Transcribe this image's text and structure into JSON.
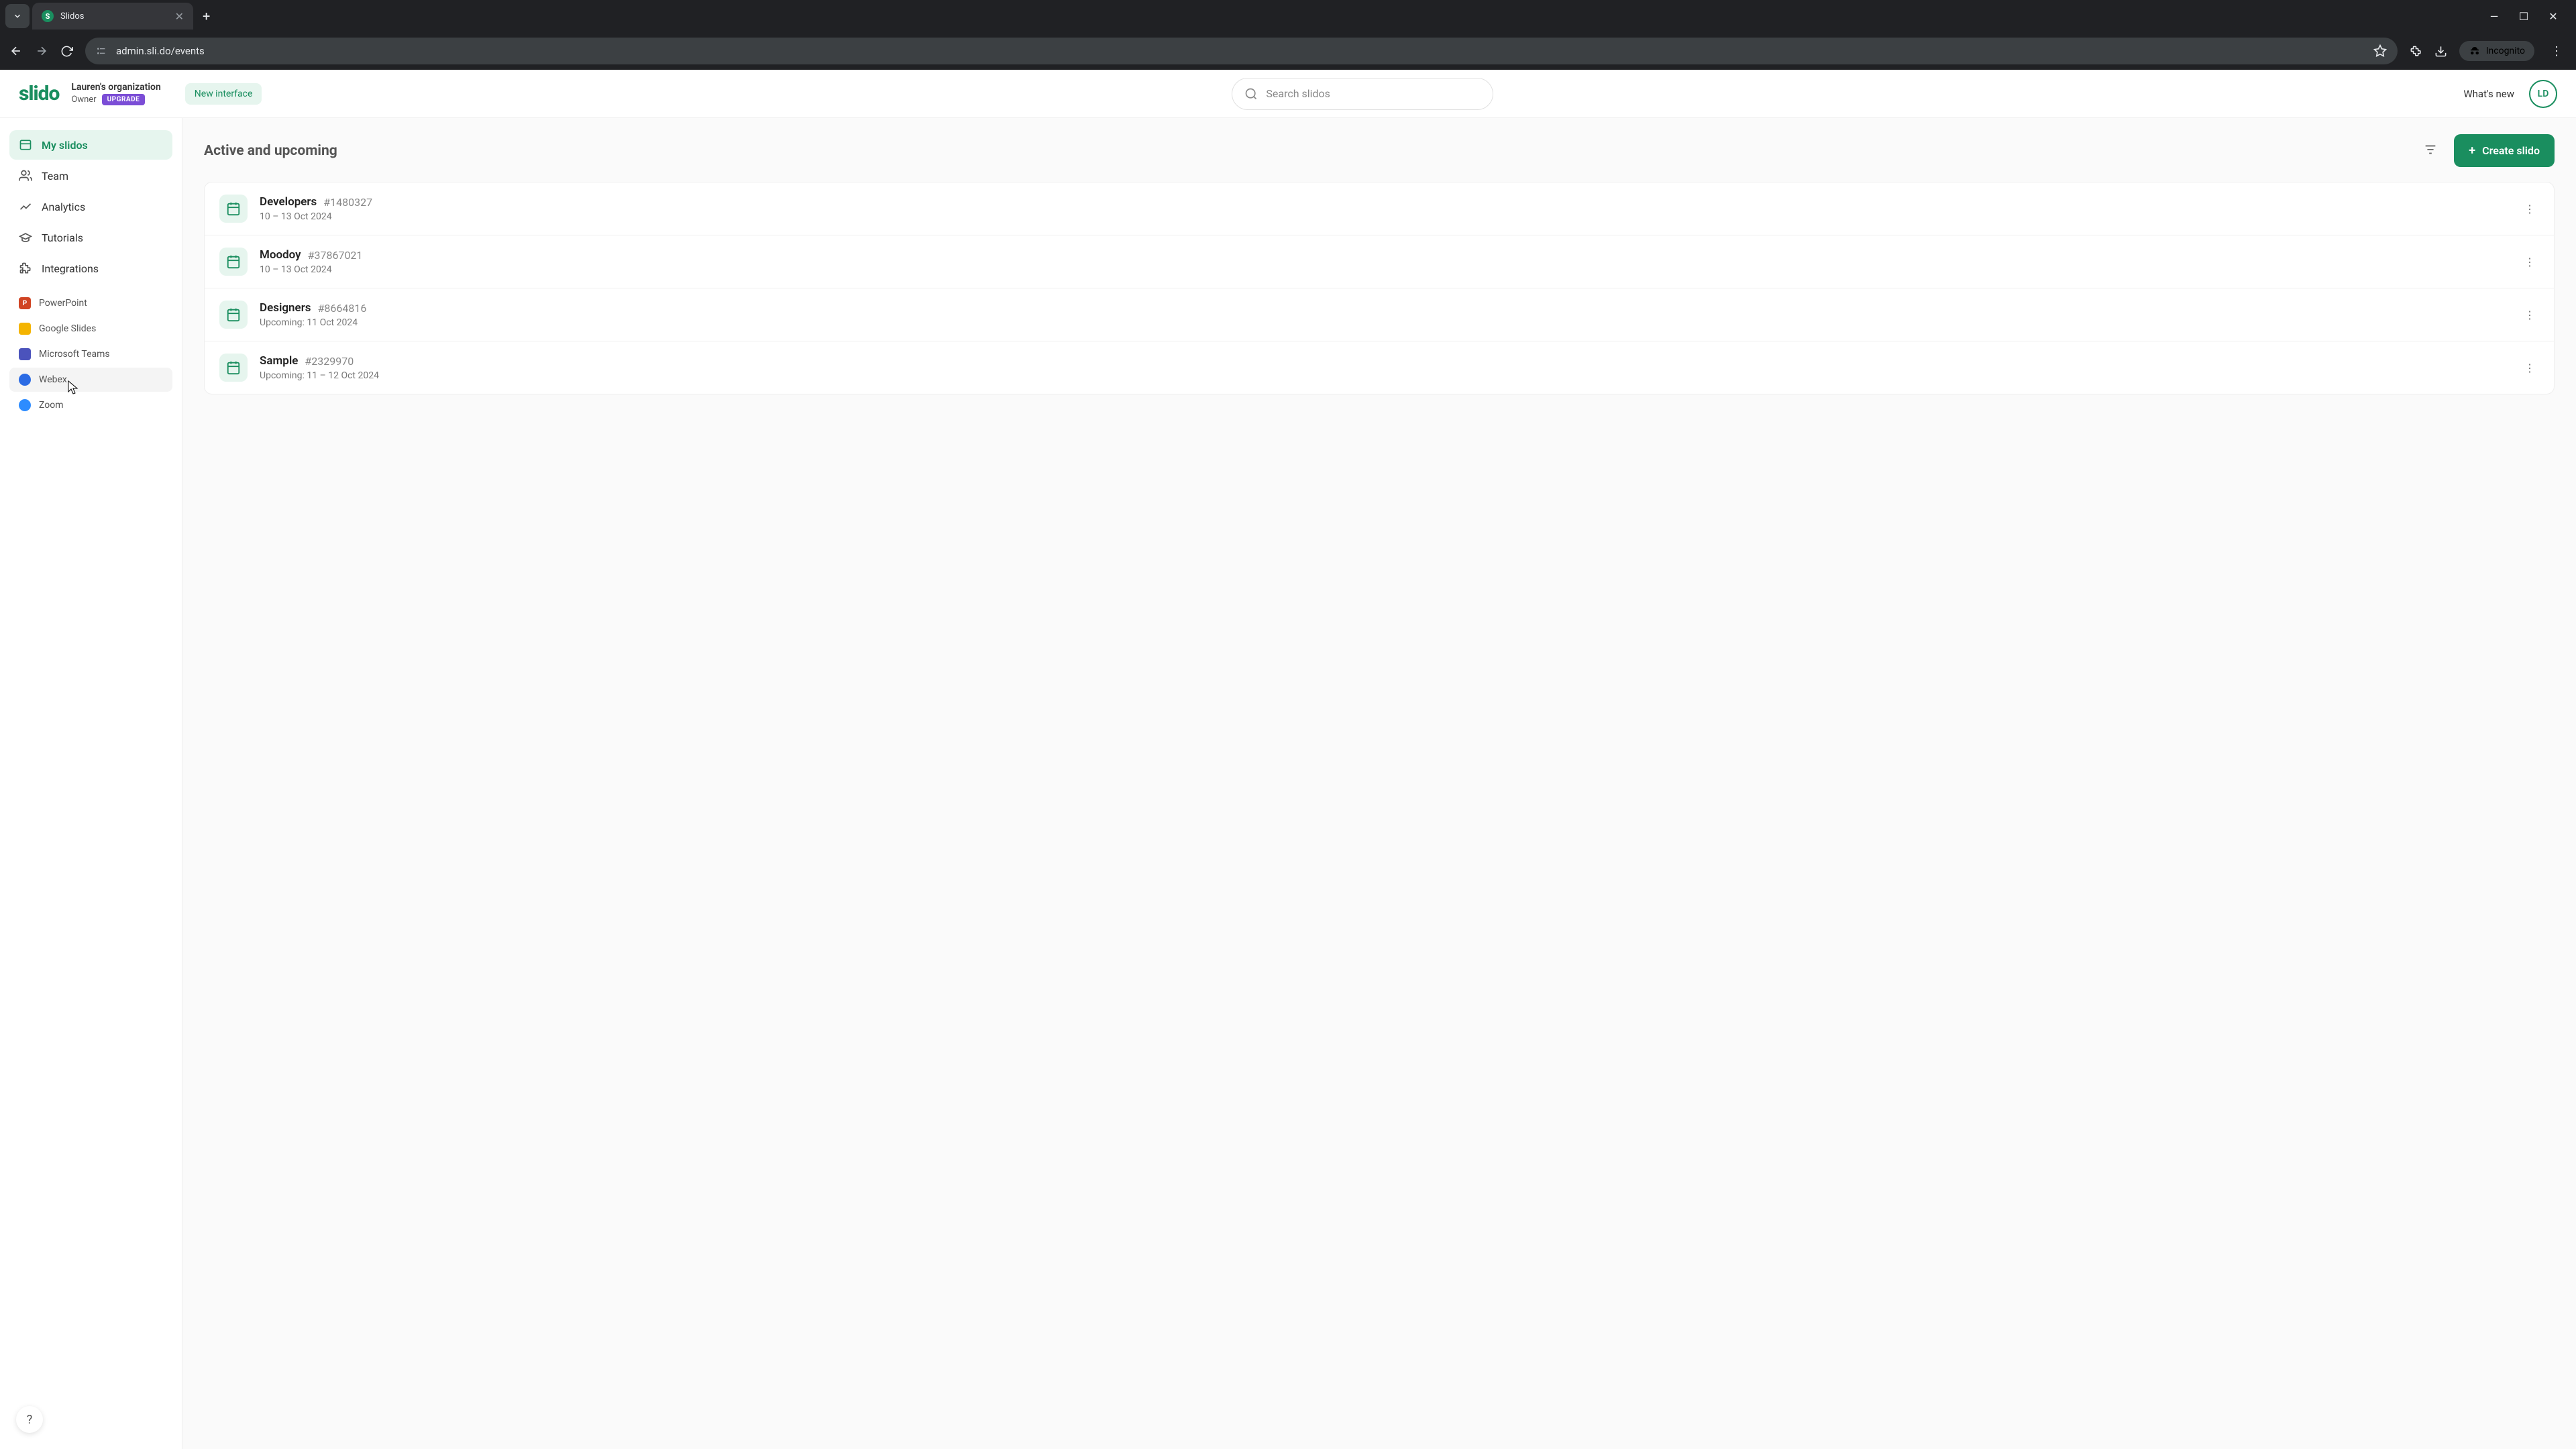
{
  "browser": {
    "tab_title": "Slidos",
    "tab_favicon_letter": "S",
    "url": "admin.sli.do/events",
    "incognito_label": "Incognito"
  },
  "header": {
    "logo_text": "slido",
    "org_name": "Lauren's organization",
    "org_role": "Owner",
    "upgrade_label": "UPGRADE",
    "new_interface_label": "New interface",
    "search_placeholder": "Search slidos",
    "whats_new": "What's new",
    "avatar_initials": "LD"
  },
  "sidebar": {
    "items": [
      {
        "label": "My slidos"
      },
      {
        "label": "Team"
      },
      {
        "label": "Analytics"
      },
      {
        "label": "Tutorials"
      },
      {
        "label": "Integrations"
      }
    ],
    "integrations": [
      {
        "label": "PowerPoint",
        "color": "#d04423",
        "letter": "P"
      },
      {
        "label": "Google Slides",
        "color": "#f4b400",
        "letter": ""
      },
      {
        "label": "Microsoft Teams",
        "color": "#4b53bc",
        "letter": ""
      },
      {
        "label": "Webex",
        "color": "#2b6be4",
        "letter": ""
      },
      {
        "label": "Zoom",
        "color": "#2d8cff",
        "letter": ""
      }
    ],
    "help_label": "?"
  },
  "main": {
    "section_title": "Active and upcoming",
    "create_label": "Create slido",
    "events": [
      {
        "name": "Developers",
        "code": "#1480327",
        "date": "10 – 13 Oct 2024"
      },
      {
        "name": "Moodoy",
        "code": "#37867021",
        "date": "10 – 13 Oct 2024"
      },
      {
        "name": "Designers",
        "code": "#8664816",
        "date": "Upcoming: 11 Oct 2024"
      },
      {
        "name": "Sample",
        "code": "#2329970",
        "date": "Upcoming: 11 – 12 Oct 2024"
      }
    ]
  },
  "colors": {
    "accent": "#1a8e5f",
    "upgrade": "#7b4dd6"
  }
}
